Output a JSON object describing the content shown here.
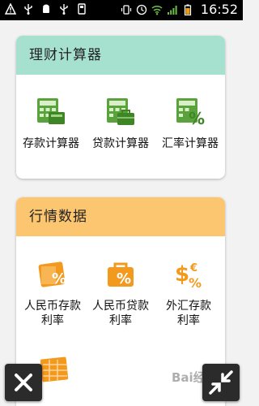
{
  "status_bar": {
    "time": "16:52",
    "icons": [
      "warning-icon",
      "usb-icon",
      "android-icon",
      "usb-icon",
      "storage-icon",
      "vibrate-icon",
      "wifi-icon",
      "signal-icon",
      "battery-icon"
    ]
  },
  "finance_card": {
    "title": "理财计算器",
    "items": [
      {
        "label": "存款计算器",
        "icon": "deposit-calculator-icon"
      },
      {
        "label": "贷款计算器",
        "icon": "loan-calculator-icon"
      },
      {
        "label": "汇率计算器",
        "icon": "exchange-rate-calculator-icon"
      }
    ]
  },
  "market_card": {
    "title": "行情数据",
    "items": [
      {
        "label_line1": "人民币存款",
        "label_line2": "利率",
        "icon": "rmb-deposit-rate-icon"
      },
      {
        "label_line1": "人民币贷款",
        "label_line2": "利率",
        "icon": "rmb-loan-rate-icon"
      },
      {
        "label_line1": "外汇存款",
        "label_line2": "利率",
        "icon": "forex-deposit-rate-icon"
      }
    ]
  },
  "watermark": "Bai经验",
  "colors": {
    "finance_header": "#a6e1d0",
    "market_header": "#fcc670",
    "finance_icon": "#5aa33c",
    "market_icon": "#f39a1e"
  }
}
